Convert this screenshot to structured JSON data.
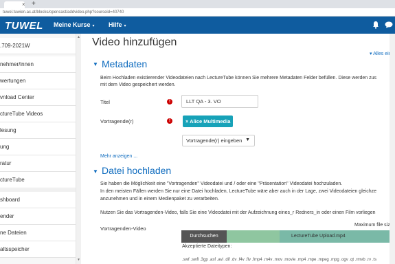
{
  "browser": {
    "tab_close": "×",
    "new_tab": "+",
    "url": "tuwel.tuwien.ac.at/blocks/opencast/addvideo.php?courseid=40740"
  },
  "navbar": {
    "logo": "TUWEL",
    "menu": [
      {
        "label": "Meine Kurse",
        "caret": "▾"
      },
      {
        "label": "Hilfe",
        "caret": "▾"
      }
    ],
    "bell_icon": "bell-icon",
    "chat_icon": "chat-icon"
  },
  "sidebar": {
    "items": [
      ".709-2021W",
      "nehmer/innen",
      "wertungen",
      "vnload Center",
      "ctureTube Videos",
      "lesung",
      "ung",
      "ratur",
      "ctureTube",
      "shboard",
      "ender",
      "ne Dateien",
      "altsspeicher"
    ],
    "scroll_up": "▲",
    "scroll_down": "▼"
  },
  "main": {
    "title": "Video hinzufügen",
    "expand_all": "▾ Alles ein",
    "metadata": {
      "caret": "▼",
      "title": "Metadaten",
      "desc_line1": "Beim Hochladen existierender Videodateien nach LectureTube können Sie mehrere Metadaten Felder befüllen. Diese werden zus",
      "desc_line2": "mit dem Video gespeichert werden.",
      "title_label": "Titel",
      "title_value": "LLT QA - 3. VO",
      "speakers_label": "Vortragende(r)",
      "required_mark": "!",
      "speaker_chip": "× Alice Multimedia",
      "speaker_select": "Vortragende(r) eingeben",
      "select_caret": "▼",
      "more_link": "Mehr anzeigen ..."
    },
    "upload": {
      "caret": "▼",
      "title": "Datei hochladen",
      "line1": "Sie haben die Möglichkeit eine \"Vortragenden\" Videodatei und / oder eine \"Präsentation\" Videodatei hochzuladen.",
      "line2": "In den meisten Fällen werden Sie nur eine Datei hochladen, LectureTube wäre aber auch in der Lage, zwei Videodateien gleichze",
      "line3": "anzunehmen und in einem Medienpaket zu verarbeiten.",
      "line4": "Nutzen Sie das Vortragenden-Video, falls Sie eine Videodatei mit der Aufzeichnung eines_r Redners_in oder einen Film vorliegen",
      "video_label": "Vortragenden-Video",
      "max_size": "Maximum file size",
      "browse_button": "Durchsuchen",
      "file_name": "LectureTube Upload.mp4",
      "accepted_label": "Akzeptierte Dateitypen:",
      "types": ".swf .swfl .3gp .asf .avi .dif .dv .f4v .flv .fmp4 .m4v .mov .movie .mp4 .mpe .mpeg .mpg .ogv .qt .rmvb .rv .ts"
    }
  }
}
